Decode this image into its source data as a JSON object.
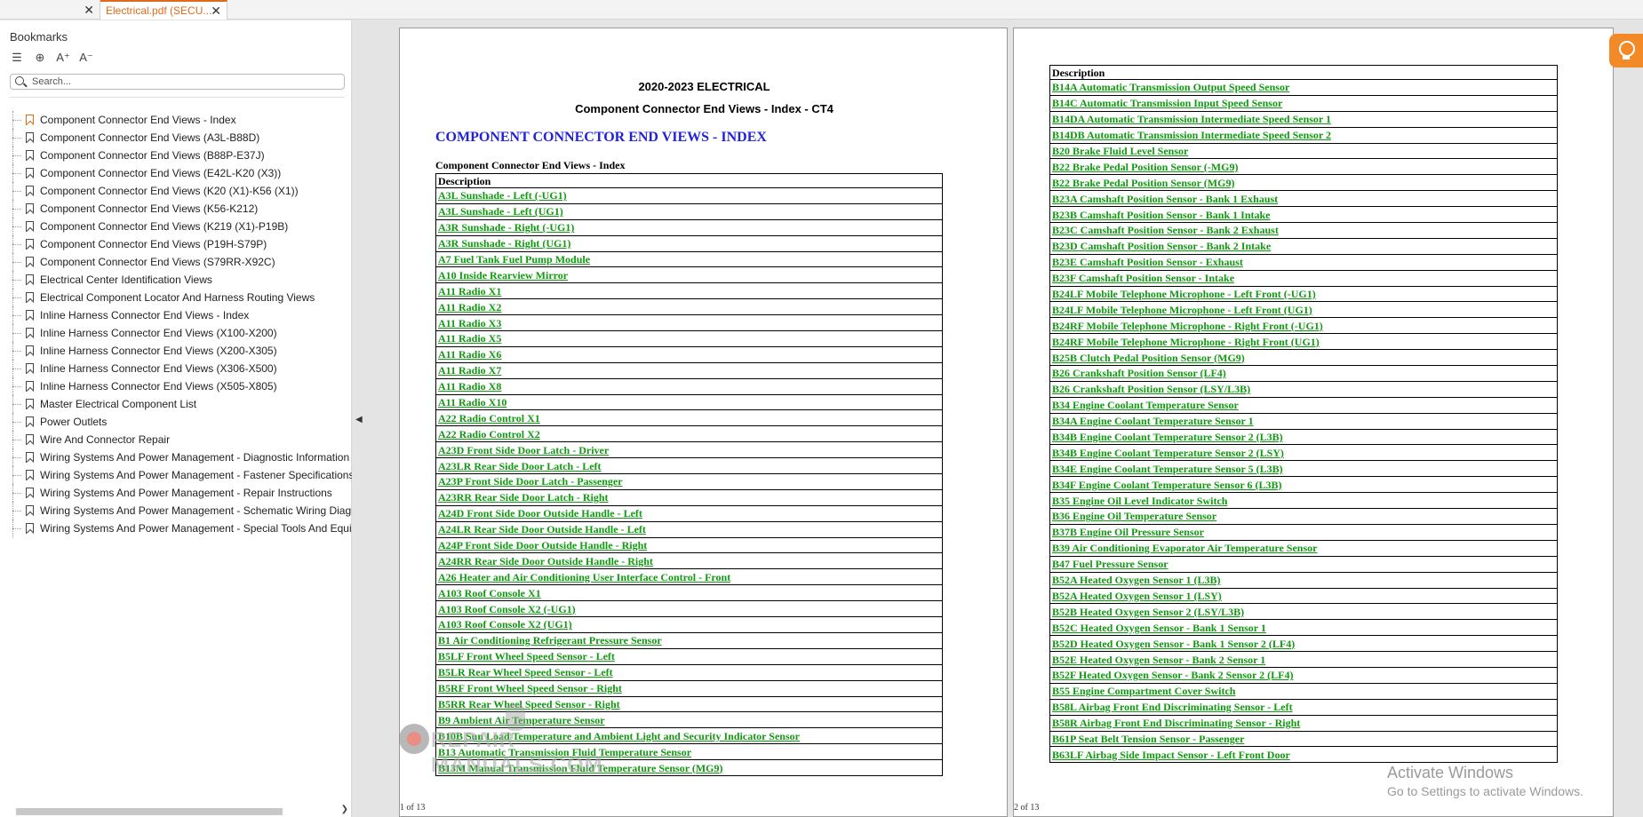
{
  "tabs": [
    {
      "label": ""
    },
    {
      "label": "Electrical.pdf (SECU..."
    }
  ],
  "sidebar": {
    "title": "Bookmarks",
    "search_placeholder": "Search...",
    "items": [
      "Component Connector End Views - Index",
      "Component Connector End Views (A3L-B88D)",
      "Component Connector End Views (B88P-E37J)",
      "Component Connector End Views (E42L-K20 (X3))",
      "Component Connector End Views (K20 (X1)-K56 (X1))",
      "Component Connector End Views (K56-K212)",
      "Component Connector End Views (K219 (X1)-P19B)",
      "Component Connector End Views (P19H-S79P)",
      "Component Connector End Views (S79RR-X92C)",
      "Electrical Center Identification Views",
      "Electrical Component Locator And Harness Routing Views",
      "Inline Harness Connector End Views - Index",
      "Inline Harness Connector End Views (X100-X200)",
      "Inline Harness Connector End Views (X200-X305)",
      "Inline Harness Connector End Views (X306-X500)",
      "Inline Harness Connector End Views (X505-X805)",
      "Master Electrical Component List",
      "Power Outlets",
      "Wire And Connector Repair",
      "Wiring Systems And Power Management - Diagnostic Information",
      "Wiring Systems And Power Management - Fastener Specifications",
      "Wiring Systems And Power Management - Repair Instructions",
      "Wiring Systems And Power Management - Schematic Wiring Diagr",
      "Wiring Systems And Power Management - Special Tools And Equip"
    ]
  },
  "page1": {
    "heading1": "2020-2023 ELECTRICAL",
    "heading2": "Component Connector End Views - Index - CT4",
    "section_title": "COMPONENT CONNECTOR END VIEWS - INDEX",
    "table_caption": "Component Connector End Views - Index",
    "col_header": "Description",
    "page_number": "1 of 13",
    "rows": [
      "A3L Sunshade - Left (-UG1)",
      "A3L Sunshade - Left (UG1)",
      "A3R Sunshade - Right (-UG1)",
      "A3R Sunshade - Right (UG1)",
      "A7 Fuel Tank Fuel Pump Module",
      "A10 Inside Rearview Mirror",
      "A11 Radio X1",
      "A11 Radio X2",
      "A11 Radio X3",
      "A11 Radio X5",
      "A11 Radio X6",
      "A11 Radio X7",
      "A11 Radio X8",
      "A11 Radio X10",
      "A22 Radio Control X1",
      "A22 Radio Control X2",
      "A23D Front Side Door Latch - Driver",
      "A23LR Rear Side Door Latch - Left",
      "A23P Front Side Door Latch - Passenger",
      "A23RR Rear Side Door Latch - Right",
      "A24D Front Side Door Outside Handle - Left",
      "A24LR Rear Side Door Outside Handle - Left",
      "A24P Front Side Door Outside Handle - Right",
      "A24RR Rear Side Door Outside Handle - Right",
      "A26 Heater and Air Conditioning User Interface Control - Front",
      "A103 Roof Console X1",
      "A103 Roof Console X2 (-UG1)",
      "A103 Roof Console X2 (UG1)",
      "B1 Air Conditioning Refrigerant Pressure Sensor",
      "B5LF Front Wheel Speed Sensor - Left",
      "B5LR Rear Wheel Speed Sensor - Left",
      "B5RF Front Wheel Speed Sensor - Right",
      "B5RR Rear Wheel Speed Sensor - Right",
      "B9 Ambient Air Temperature Sensor",
      "B10B Sun Load Temperature and Ambient Light and Security Indicator Sensor",
      "B13 Automatic Transmission Fluid Temperature Sensor",
      "B13M Manual Transmission Fluid Temperature Sensor (MG9)"
    ]
  },
  "page2": {
    "col_header": "Description",
    "page_number": "2 of 13",
    "rows": [
      "B14A Automatic Transmission Output Speed Sensor",
      "B14C Automatic Transmission Input Speed Sensor",
      "B14DA Automatic Transmission Intermediate Speed Sensor 1",
      "B14DB Automatic Transmission Intermediate Speed Sensor 2",
      "B20 Brake Fluid Level Sensor",
      "B22 Brake Pedal Position Sensor (-MG9)",
      "B22 Brake Pedal Position Sensor (MG9)",
      "B23A Camshaft Position Sensor - Bank 1 Exhaust",
      "B23B Camshaft Position Sensor - Bank 1 Intake",
      "B23C Camshaft Position Sensor - Bank 2 Exhaust",
      "B23D Camshaft Position Sensor - Bank 2 Intake",
      "B23E Camshaft Position Sensor - Exhaust",
      "B23F Camshaft Position Sensor - Intake",
      "B24LF Mobile Telephone Microphone - Left Front (-UG1)",
      "B24LF Mobile Telephone Microphone - Left Front (UG1)",
      "B24RF Mobile Telephone Microphone - Right Front (-UG1)",
      "B24RF Mobile Telephone Microphone - Right Front (UG1)",
      "B25B Clutch Pedal Position Sensor (MG9)",
      "B26 Crankshaft Position Sensor (LF4)",
      "B26 Crankshaft Position Sensor (LSY/L3B)",
      "B34 Engine Coolant Temperature Sensor",
      "B34A Engine Coolant Temperature Sensor 1",
      "B34B Engine Coolant Temperature Sensor 2 (L3B)",
      "B34B Engine Coolant Temperature Sensor 2 (LSY)",
      "B34E Engine Coolant Temperature Sensor 5 (L3B)",
      "B34F Engine Coolant Temperature Sensor 6 (L3B)",
      "B35 Engine Oil Level Indicator Switch",
      "B36 Engine Oil Temperature Sensor",
      "B37B Engine Oil Pressure Sensor",
      "B39 Air Conditioning Evaporator Air Temperature Sensor",
      "B47 Fuel Pressure Sensor",
      "B52A Heated Oxygen Sensor 1 (L3B)",
      "B52A Heated Oxygen Sensor 1 (LSY)",
      "B52B Heated Oxygen Sensor 2 (LSY/L3B)",
      "B52C Heated Oxygen Sensor - Bank 1 Sensor 1",
      "B52D Heated Oxygen Sensor - Bank 1 Sensor 2 (LF4)",
      "B52E Heated Oxygen Sensor - Bank 2 Sensor 1",
      "B52F Heated Oxygen Sensor - Bank 2 Sensor 2 (LF4)",
      "B55 Engine Compartment Cover Switch",
      "B58L Airbag Front End Discriminating Sensor - Left",
      "B58R Airbag Front End Discriminating Sensor - Right",
      "B61P Seat Belt Tension Sensor - Passenger",
      "B63LF Airbag Side Impact Sensor - Left Front Door"
    ]
  },
  "watermark": {
    "text": "REPAIR-MANUALS.COM"
  },
  "activate_windows": {
    "line1": "Activate Windows",
    "line2": "Go to Settings to activate Windows."
  }
}
